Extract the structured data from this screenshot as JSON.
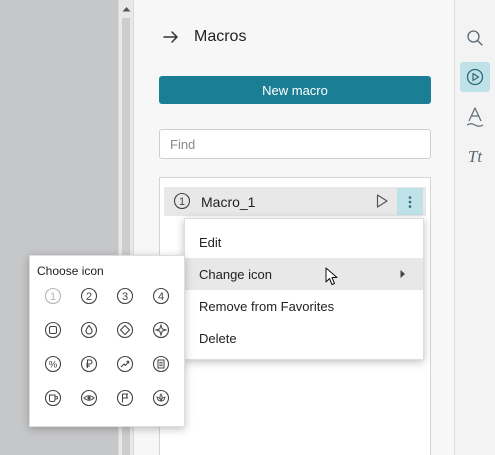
{
  "panel": {
    "title": "Macros",
    "new_macro_label": "New macro",
    "find_placeholder": "Find"
  },
  "macros": [
    {
      "name": "Macro_1",
      "icon": "circled-number-1-icon"
    }
  ],
  "context_menu": {
    "items": [
      {
        "label": "Edit"
      },
      {
        "label": "Change icon",
        "has_submenu": true,
        "hovered": true
      },
      {
        "label": "Remove from Favorites"
      },
      {
        "label": "Delete"
      }
    ]
  },
  "icon_picker": {
    "title": "Choose icon",
    "icons": [
      "circled-1-icon",
      "circled-2-icon",
      "circled-3-icon",
      "circled-4-icon",
      "square-icon",
      "drop-icon",
      "diamond-icon",
      "compass-icon",
      "percent-icon",
      "ruble-icon",
      "trend-arrow-icon",
      "document-icon",
      "cup-icon",
      "eye-icon",
      "flag-icon",
      "flower-icon"
    ]
  },
  "sidebar": {
    "items": [
      {
        "icon": "search-icon",
        "active": false
      },
      {
        "icon": "play-macros-icon",
        "active": true
      },
      {
        "icon": "text-art-icon",
        "active": false
      },
      {
        "icon": "font-style-icon",
        "active": false,
        "text": "Tt"
      }
    ]
  },
  "colors": {
    "accent": "#1a7f94",
    "active_bg": "#bfe1e8",
    "hover_bg": "#e8e8e8",
    "doc_bg": "#c6c7c9"
  }
}
